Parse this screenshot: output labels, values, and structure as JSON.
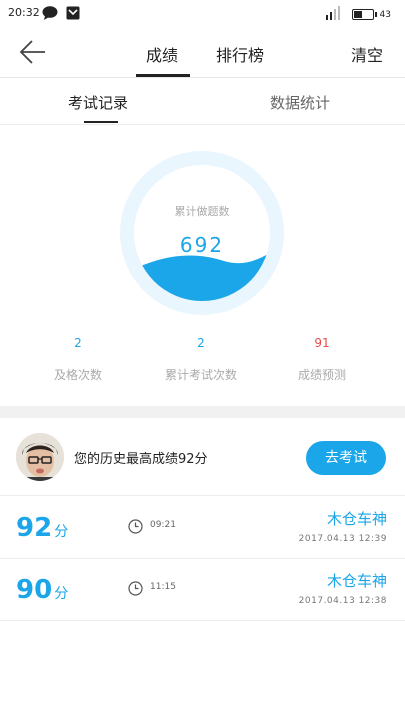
{
  "status_bar": {
    "time": "20:32",
    "signal_label": "4G",
    "battery": "43"
  },
  "nav": {
    "tabs": [
      {
        "label": "成绩",
        "active": true
      },
      {
        "label": "排行榜",
        "active": false
      }
    ],
    "clear_label": "清空"
  },
  "subtabs": [
    {
      "label": "考试记录",
      "active": true
    },
    {
      "label": "数据统计",
      "active": false
    }
  ],
  "gauge": {
    "label": "累计做题数",
    "value": "692"
  },
  "stats": [
    {
      "value": "2",
      "label": "及格次数",
      "color": "#1aa6e8"
    },
    {
      "value": "2",
      "label": "累计考试次数",
      "color": "#1aa6e8"
    },
    {
      "value": "91",
      "label": "成绩预测",
      "color": "#e84c4c"
    }
  ],
  "best": {
    "text": "您的历史最高成绩92分",
    "button": "去考试"
  },
  "records": [
    {
      "score": "92",
      "unit": "分",
      "duration": "09:21",
      "author": "木仓车神",
      "date": "2017.04.13   12:39"
    },
    {
      "score": "90",
      "unit": "分",
      "duration": "11:15",
      "author": "木仓车神",
      "date": "2017.04.13   12:38"
    }
  ],
  "colors": {
    "accent": "#1aa6e8",
    "danger": "#e84c4c"
  }
}
